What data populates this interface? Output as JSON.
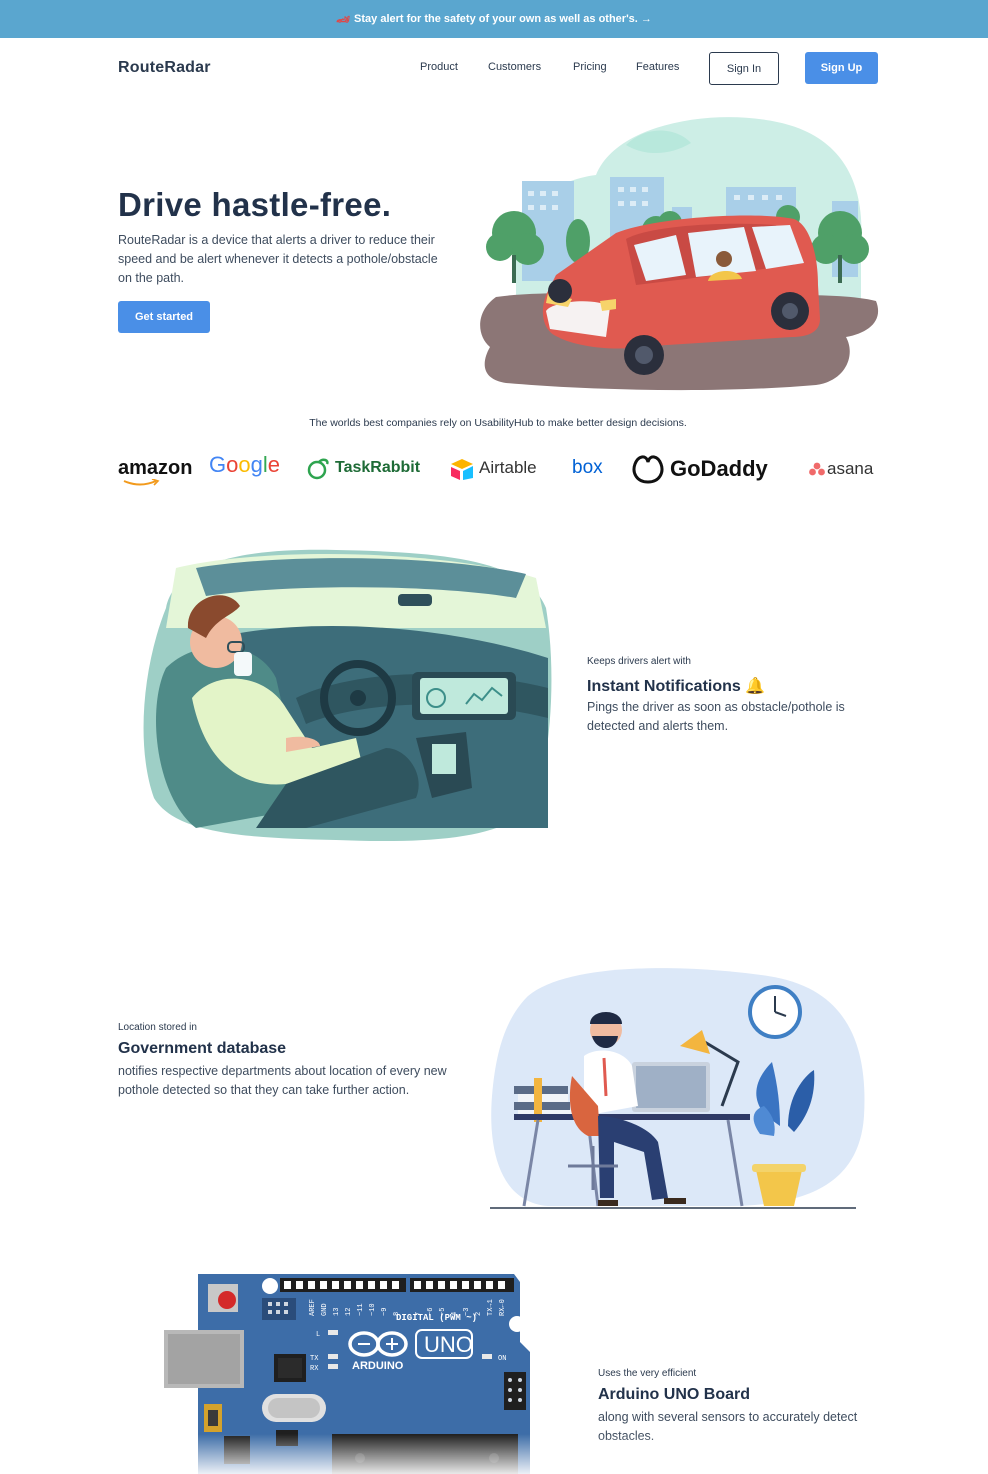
{
  "banner": {
    "icon": "car-icon",
    "text": "Stay alert for the safety of your own as well as other's. →"
  },
  "nav": {
    "brand": "RouteRadar",
    "links": [
      "Product",
      "Customers",
      "Pricing",
      "Features"
    ],
    "sign_in": "Sign In",
    "sign_up": "Sign Up"
  },
  "hero": {
    "title": "Drive hastle-free.",
    "description": "RouteRadar is a device that alerts a driver to reduce their speed and be alert whenever it detects a pothole/obstacle on the path.",
    "cta": "Get started"
  },
  "trust": {
    "text": "The worlds best companies rely on UsabilityHub to make better design decisions.",
    "logos": [
      "amazon",
      "Google",
      "TaskRabbit",
      "Airtable",
      "box",
      "GoDaddy",
      "asana"
    ]
  },
  "features": [
    {
      "kicker": "Keeps drivers alert with",
      "title": "Instant Notifications 🔔",
      "description": "Pings the driver as soon as obstacle/pothole is detected and alerts them."
    },
    {
      "kicker": "Location stored in",
      "title": "Government database",
      "description": "notifies respective departments about location of every new pothole detected so that they can take further action."
    },
    {
      "kicker": "Uses the very efficient",
      "title": "Arduino UNO Board",
      "description": "along with several sensors to accurately detect obstacles."
    }
  ],
  "arduino": {
    "brand": "ARDUINO",
    "model": "UNO",
    "digital_label": "DIGITAL (PWM ~)",
    "on_label": "ON",
    "pin_labels": [
      "AREF",
      "GND",
      "13",
      "12",
      "~11",
      "~10",
      "~9",
      "8",
      "7",
      "~6",
      "~5",
      "4",
      "~3",
      "2",
      "TX→1",
      "RX←0"
    ],
    "led_labels": [
      "L",
      "TX",
      "RX"
    ]
  },
  "colors": {
    "banner": "#5aa6cf",
    "primary": "#4a8fe7",
    "heading": "#22324a",
    "car": "#e05a50",
    "board": "#3d6da8"
  }
}
